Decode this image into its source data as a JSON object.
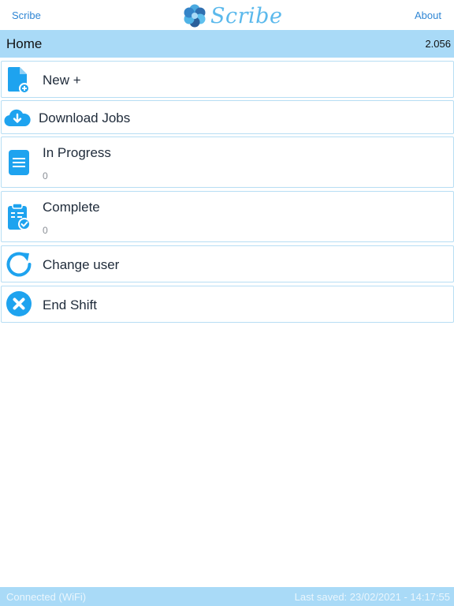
{
  "topbar": {
    "left_link": "Scribe",
    "logo_text": "Scribe",
    "right_link": "About"
  },
  "header": {
    "title": "Home",
    "version": "2.056"
  },
  "menu": {
    "items": [
      {
        "label": "New +",
        "icon": "new-document-icon"
      },
      {
        "label": "Download Jobs",
        "icon": "cloud-download-icon"
      },
      {
        "label": "In Progress",
        "count": "0",
        "icon": "document-lines-icon"
      },
      {
        "label": "Complete",
        "count": "0",
        "icon": "clipboard-check-icon"
      },
      {
        "label": "Change user",
        "icon": "refresh-icon"
      },
      {
        "label": "End Shift",
        "icon": "close-circle-icon"
      }
    ]
  },
  "footer": {
    "status": "Connected (WiFi)",
    "last_saved": "Last saved: 23/02/2021 - 14:17:55"
  },
  "colors": {
    "accent": "#a9daf7",
    "icon_blue": "#1ea3ef",
    "link_blue": "#2f86d4",
    "item_border": "#b7def4"
  }
}
